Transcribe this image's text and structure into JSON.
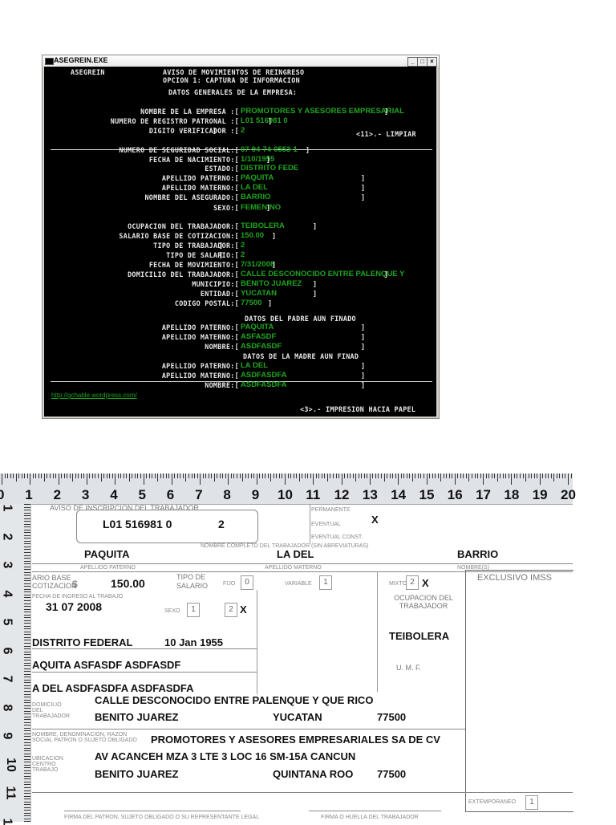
{
  "window": {
    "title": "ASEGREIN.EXE",
    "minimize": "_",
    "maximize": "□",
    "close": "×"
  },
  "console": {
    "app_name": "ASEGREIN",
    "header1": "AVISO DE MOVIMIENTOS DE REINGRESO",
    "header2": "OPCION 1: CAPTURA DE INFORMACION",
    "section_empresa": "DATOS GENERALES DE LA EMPRESA:",
    "limpiar": "<11>.- LIMPIAR",
    "fields": [
      {
        "label": "NOMBRE DE LA EMPRESA :[",
        "value": "PROMOTORES Y ASESORES EMPRESARIAL"
      },
      {
        "label": "NUMERO DE REGISTRO PATRONAL :[",
        "value": "L01 516981 0"
      },
      {
        "label": "DIGITO VERIFICADOR :[",
        "value": "2"
      },
      {
        "label": "NUMERO DE SEGURIDAD SOCIAL:[",
        "value": "07-94-74-0553-1"
      },
      {
        "label": "FECHA DE NACIMIENTO:[",
        "value": "1/10/1955"
      },
      {
        "label": "ESTADO:[",
        "value": "DISTRITO FEDE"
      },
      {
        "label": "APELLIDO PATERNO:[",
        "value": "PAQUITA"
      },
      {
        "label": "APELLIDO MATERNO:[",
        "value": "LA DEL"
      },
      {
        "label": "NOMBRE DEL ASEGURADO:[",
        "value": "BARRIO"
      },
      {
        "label": "SEXO:[",
        "value": "FEMENINO"
      },
      {
        "label": "OCUPACION DEL TRABAJADOR:[",
        "value": "TEIBOLERA"
      },
      {
        "label": "SALARIO BASE DE COTIZACION:[",
        "value": "150.00"
      },
      {
        "label": "TIPO DE TRABAJADOR:[",
        "value": "2"
      },
      {
        "label": "TIPO DE SALARIO:[",
        "value": "2"
      },
      {
        "label": "FECHA DE MOVIMIENTO:[",
        "value": "7/31/2008"
      },
      {
        "label": "DOMICILIO DEL TRABAJADOR:[",
        "value": "CALLE DESCONOCIDO ENTRE PALENQUE Y"
      },
      {
        "label": "MUNICIPIO:[",
        "value": "BENITO JUAREZ"
      },
      {
        "label": "ENTIDAD:[",
        "value": "YUCATAN"
      },
      {
        "label": "CODIGO POSTAL:[",
        "value": "77500"
      }
    ],
    "section_padre": "DATOS DEL PADRE AUN FINADO",
    "padre": [
      {
        "label": "APELLIDO PATERNO:[",
        "value": "PAQUITA"
      },
      {
        "label": "APELLIDO MATERNO:[",
        "value": "ASFASDF"
      },
      {
        "label": "NOMBRE:[",
        "value": "ASDFASDF"
      }
    ],
    "section_madre": "DATOS DE LA MADRE AUN FINAD",
    "madre": [
      {
        "label": "APELLIDO PATERNO:[",
        "value": "LA DEL"
      },
      {
        "label": "APELLIDO MATERNO:[",
        "value": "ASDFASDFA"
      },
      {
        "label": "NOMBRE:[",
        "value": "ASDFASDFA"
      }
    ],
    "close_bracket": "]",
    "link": "http://gchable.wordpress.com/",
    "impresion": "<3>.- IMPRESION HACIA PAPEL"
  },
  "paper": {
    "ruler_top": [
      "0",
      "1",
      "2",
      "3",
      "4",
      "5",
      "6",
      "7",
      "8",
      "9",
      "10",
      "11",
      "12",
      "13",
      "14",
      "15",
      "16",
      "17",
      "18",
      "19",
      "20"
    ],
    "ruler_left": [
      "1",
      "2",
      "3",
      "4",
      "5",
      "6",
      "7",
      "8",
      "9",
      "10",
      "11",
      "1"
    ],
    "form_title": "AVISO DE INSCRIPCION DEL TRABAJADOR",
    "registro": "L01 516981 0",
    "digito": "2",
    "permanente": "PERMANENTE",
    "eventual": "EVENTUAL",
    "eventual_const": "EVENTUAL CONST.",
    "tipo_x": "X",
    "nombre_caption": "NOMBRE COMPLETO DEL TRABAJADOR (SIN ABREVIATURAS)",
    "ap_paterno": "PAQUITA",
    "ap_materno": "LA DEL",
    "nombre": "BARRIO",
    "cap_paterno": "APELLIDO PATERNO",
    "cap_materno": "APELLIDO MATERNO",
    "cap_nombre": "NOMBRE(S)",
    "salario_label": "ARIO BASE COTIZACION",
    "currency": "$",
    "salario": "150.00",
    "tipo_salario_label": "TIPO DE SALARIO",
    "fijo": "FIJO",
    "fijo_n": "0",
    "variable": "VARIABLE",
    "variable_n": "1",
    "mixto": "MIXTO",
    "mixto_n": "2",
    "mixto_x": "X",
    "exclusivo": "EXCLUSIVO IMSS",
    "fecha_ingreso_label": "FECHA DE INGRESO AL TRABAJO",
    "fecha_ingreso": "31  07  2008",
    "sexo_label": "SEXO",
    "sexo_m": "1",
    "sexo_f": "2",
    "sexo_x": "X",
    "ocupacion_label": "OCUPACION DEL TRABAJADOR",
    "ocupacion": "TEIBOLERA",
    "lugar_nac": "DISTRITO FEDERAL",
    "fecha_nac": "10  Jan 1955",
    "umf": "U. M. F.",
    "padre": "AQUITA ASFASDF ASDFASDF",
    "madre": "A DEL ASDFASDFA ASDFASDFA",
    "domicilio": "CALLE DESCONOCIDO ENTRE PALENQUE Y QUE RICO",
    "dom_municipio": "BENITO JUAREZ",
    "dom_entidad": "YUCATAN",
    "dom_cp": "77500",
    "domicilio_label": "DOMICILIO DEL TRABAJADOR",
    "patron_label": "NOMBRE, DENOMINACION, RAZON SOCIAL PATRON O SUJETO OBLIGADO",
    "empresa": "PROMOTORES Y ASESORES EMPRESARIALES SA DE CV",
    "centro_dir": "AV ACANCEH MZA 3 LTE 3 LOC 16 SM-15A CANCUN",
    "centro_municipio": "BENITO JUAREZ",
    "centro_entidad": "QUINTANA ROO",
    "centro_cp": "77500",
    "centro_label": "UBICACION CENTRO TRABAJO",
    "extemporaneo": "EXTEMPORANEO",
    "extemporaneo_n": "1",
    "firma_patron": "FIRMA DEL PATRON, SUJETO OBLIGADO O SU REPRESENTANTE LEGAL",
    "firma_trabajador": "FIRMA O HUELLA DEL TRABAJADOR"
  }
}
